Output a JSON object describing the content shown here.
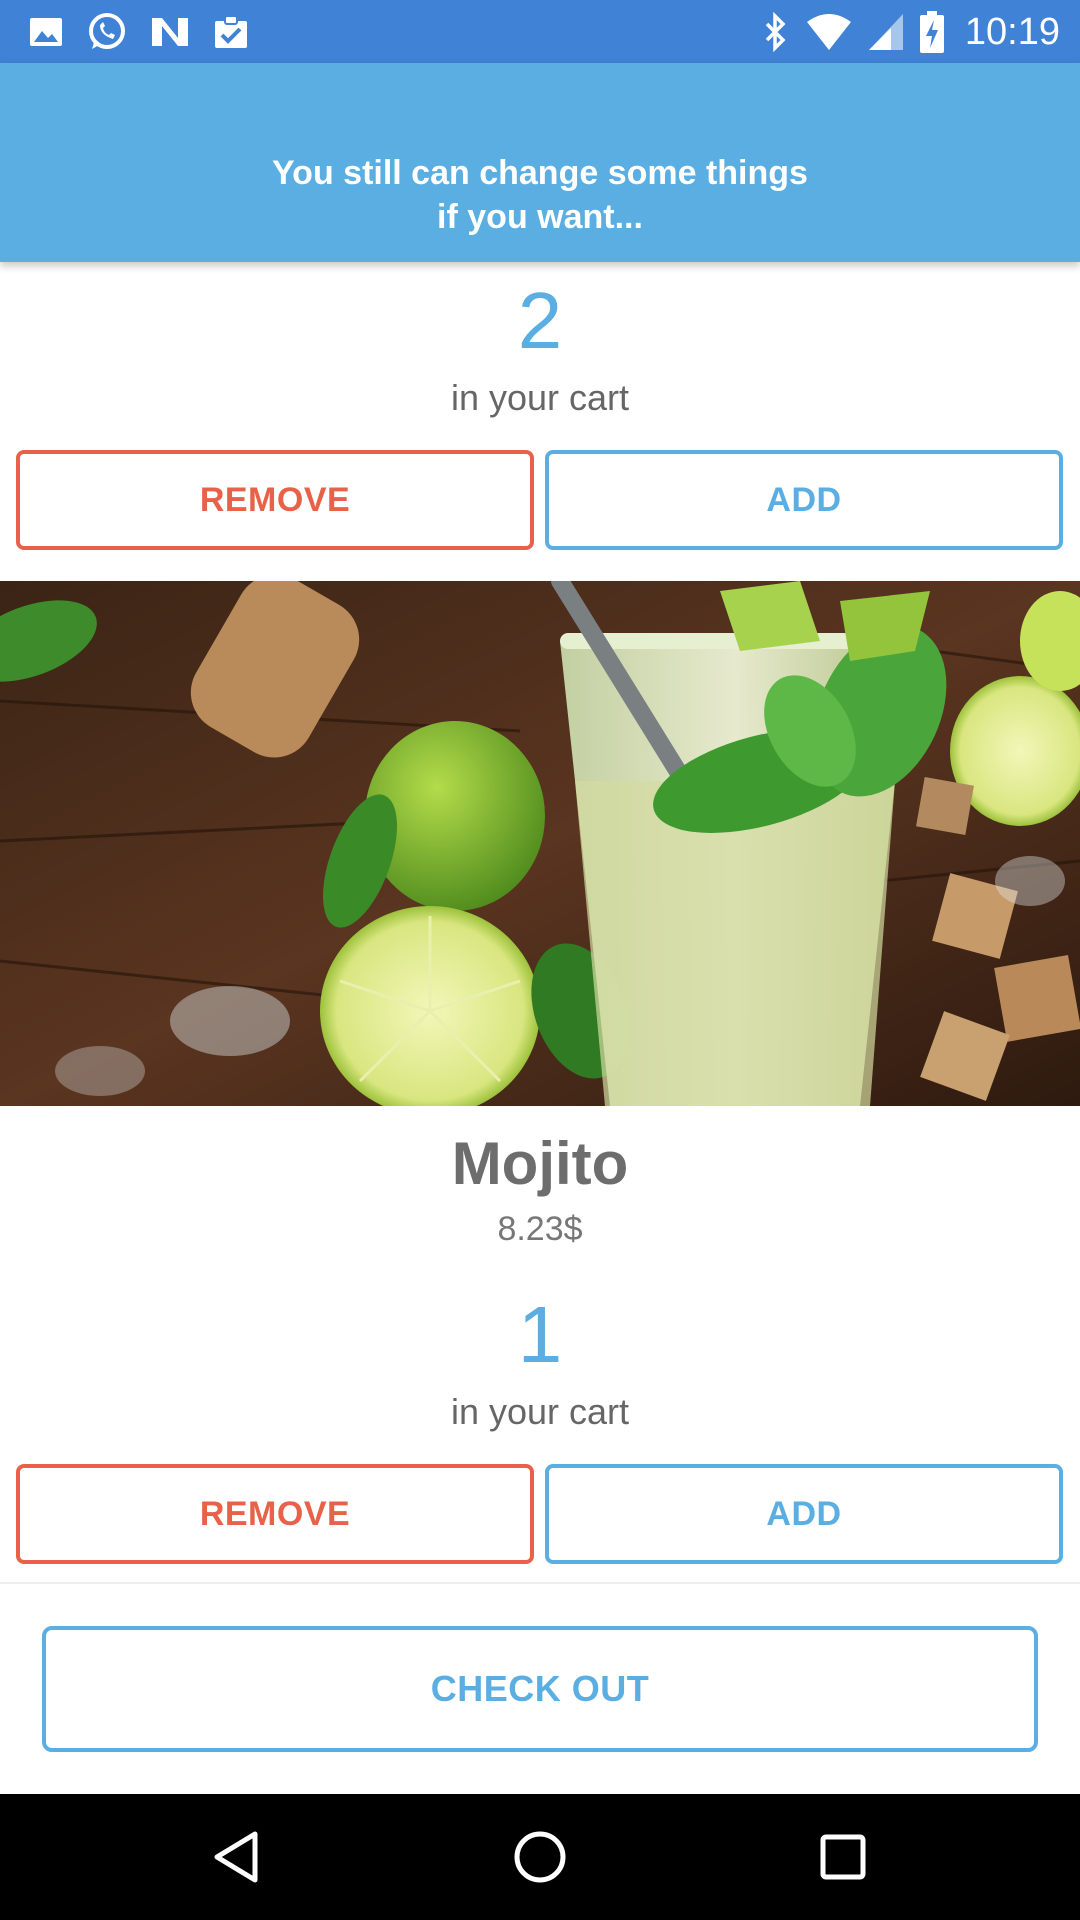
{
  "status_bar": {
    "time": "10:19",
    "left_icons": [
      "gallery-icon",
      "whatsapp-icon",
      "n-app-icon",
      "clipboard-icon"
    ],
    "right_icons": [
      "bluetooth-icon",
      "wifi-icon",
      "cellular-signal-icon",
      "battery-charging-icon"
    ]
  },
  "header": {
    "title_line1": "You still can change some things",
    "title_line2": "if you want...",
    "background": "#5aaee2"
  },
  "cart_items": [
    {
      "quantity": "2",
      "quantity_label": "in your cart",
      "remove_label": "REMOVE",
      "add_label": "ADD"
    },
    {
      "name": "Mojito",
      "price": "8.23$",
      "quantity": "1",
      "quantity_label": "in your cart",
      "remove_label": "REMOVE",
      "add_label": "ADD"
    }
  ],
  "checkout": {
    "label": "CHECK OUT"
  },
  "nav_bar": {
    "icons": [
      "back-icon",
      "home-icon",
      "recents-icon"
    ]
  },
  "colors": {
    "status_bar": "#3f82d6",
    "accent_blue": "#5aaee2",
    "remove_red": "#e8624a",
    "text_gray": "#6d6d6d"
  }
}
